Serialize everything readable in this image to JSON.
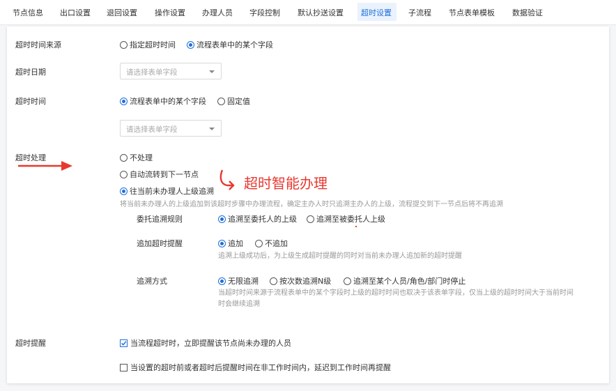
{
  "tabs": [
    {
      "label": "节点信息",
      "active": false
    },
    {
      "label": "出口设置",
      "active": false
    },
    {
      "label": "退回设置",
      "active": false
    },
    {
      "label": "操作设置",
      "active": false
    },
    {
      "label": "办理人员",
      "active": false
    },
    {
      "label": "字段控制",
      "active": false
    },
    {
      "label": "默认抄送设置",
      "active": false
    },
    {
      "label": "超时设置",
      "active": true
    },
    {
      "label": "子流程",
      "active": false
    },
    {
      "label": "节点表单模板",
      "active": false
    },
    {
      "label": "数据验证",
      "active": false
    }
  ],
  "timeout_source": {
    "label": "超时时间来源",
    "opt1": "指定超时时间",
    "opt2": "流程表单中的某个字段",
    "selected": 2
  },
  "timeout_date": {
    "label": "超时日期",
    "placeholder": "请选择表单字段"
  },
  "timeout_time": {
    "label": "超时时间",
    "opt1": "流程表单中的某个字段",
    "opt2": "固定值",
    "selected": 1,
    "placeholder": "请选择表单字段"
  },
  "timeout_handling": {
    "label": "超时处理",
    "opt1": "不处理",
    "opt2": "自动流转到下一节点",
    "opt3": "往当前未办理人上级追溯",
    "selected": 3,
    "hint": "将当前未办理人的上级追加到该超时步骤中办理流程，确定主办人时只追溯主办人的上级，流程提交到下一节点后将不再追溯"
  },
  "annotation": {
    "text": "超时智能办理",
    "color": "#e8382f"
  },
  "delegate_rule": {
    "label": "委托追溯规则",
    "opt1": "追溯至委托人的上级",
    "opt2": "追溯至被委托人上级",
    "selected": 1
  },
  "append_reminder": {
    "label": "追加超时提醒",
    "opt1": "追加",
    "opt2": "不追加",
    "selected": 1,
    "hint": "追溯上级成功后，为上级生成超时提醒的同时对当前未办理人追加新的超时提醒"
  },
  "trace_mode": {
    "label": "追溯方式",
    "opt1": "无限追溯",
    "opt2": "按次数追溯N级",
    "opt3": "追溯至某个人员/角色/部门时停止",
    "selected": 1,
    "hint_line1": "当超时时间来源于流程表单中的某个字段时上级的超时时间也取决于该表单字段，仅当上级的超时时间大于当前时间",
    "hint_line2": "时会继续追溯"
  },
  "timeout_reminder": {
    "label": "超时提醒",
    "check1": "当流程超时时，立即提醒该节点尚未办理的人员",
    "check1_checked": true,
    "check2": "当设置的超时前或者超时后提醒时间在非工作时间内，延迟到工作时间再提醒",
    "check2_checked": false
  },
  "colors": {
    "accent": "#1e6fd9",
    "annotation_red": "#e8382f"
  }
}
